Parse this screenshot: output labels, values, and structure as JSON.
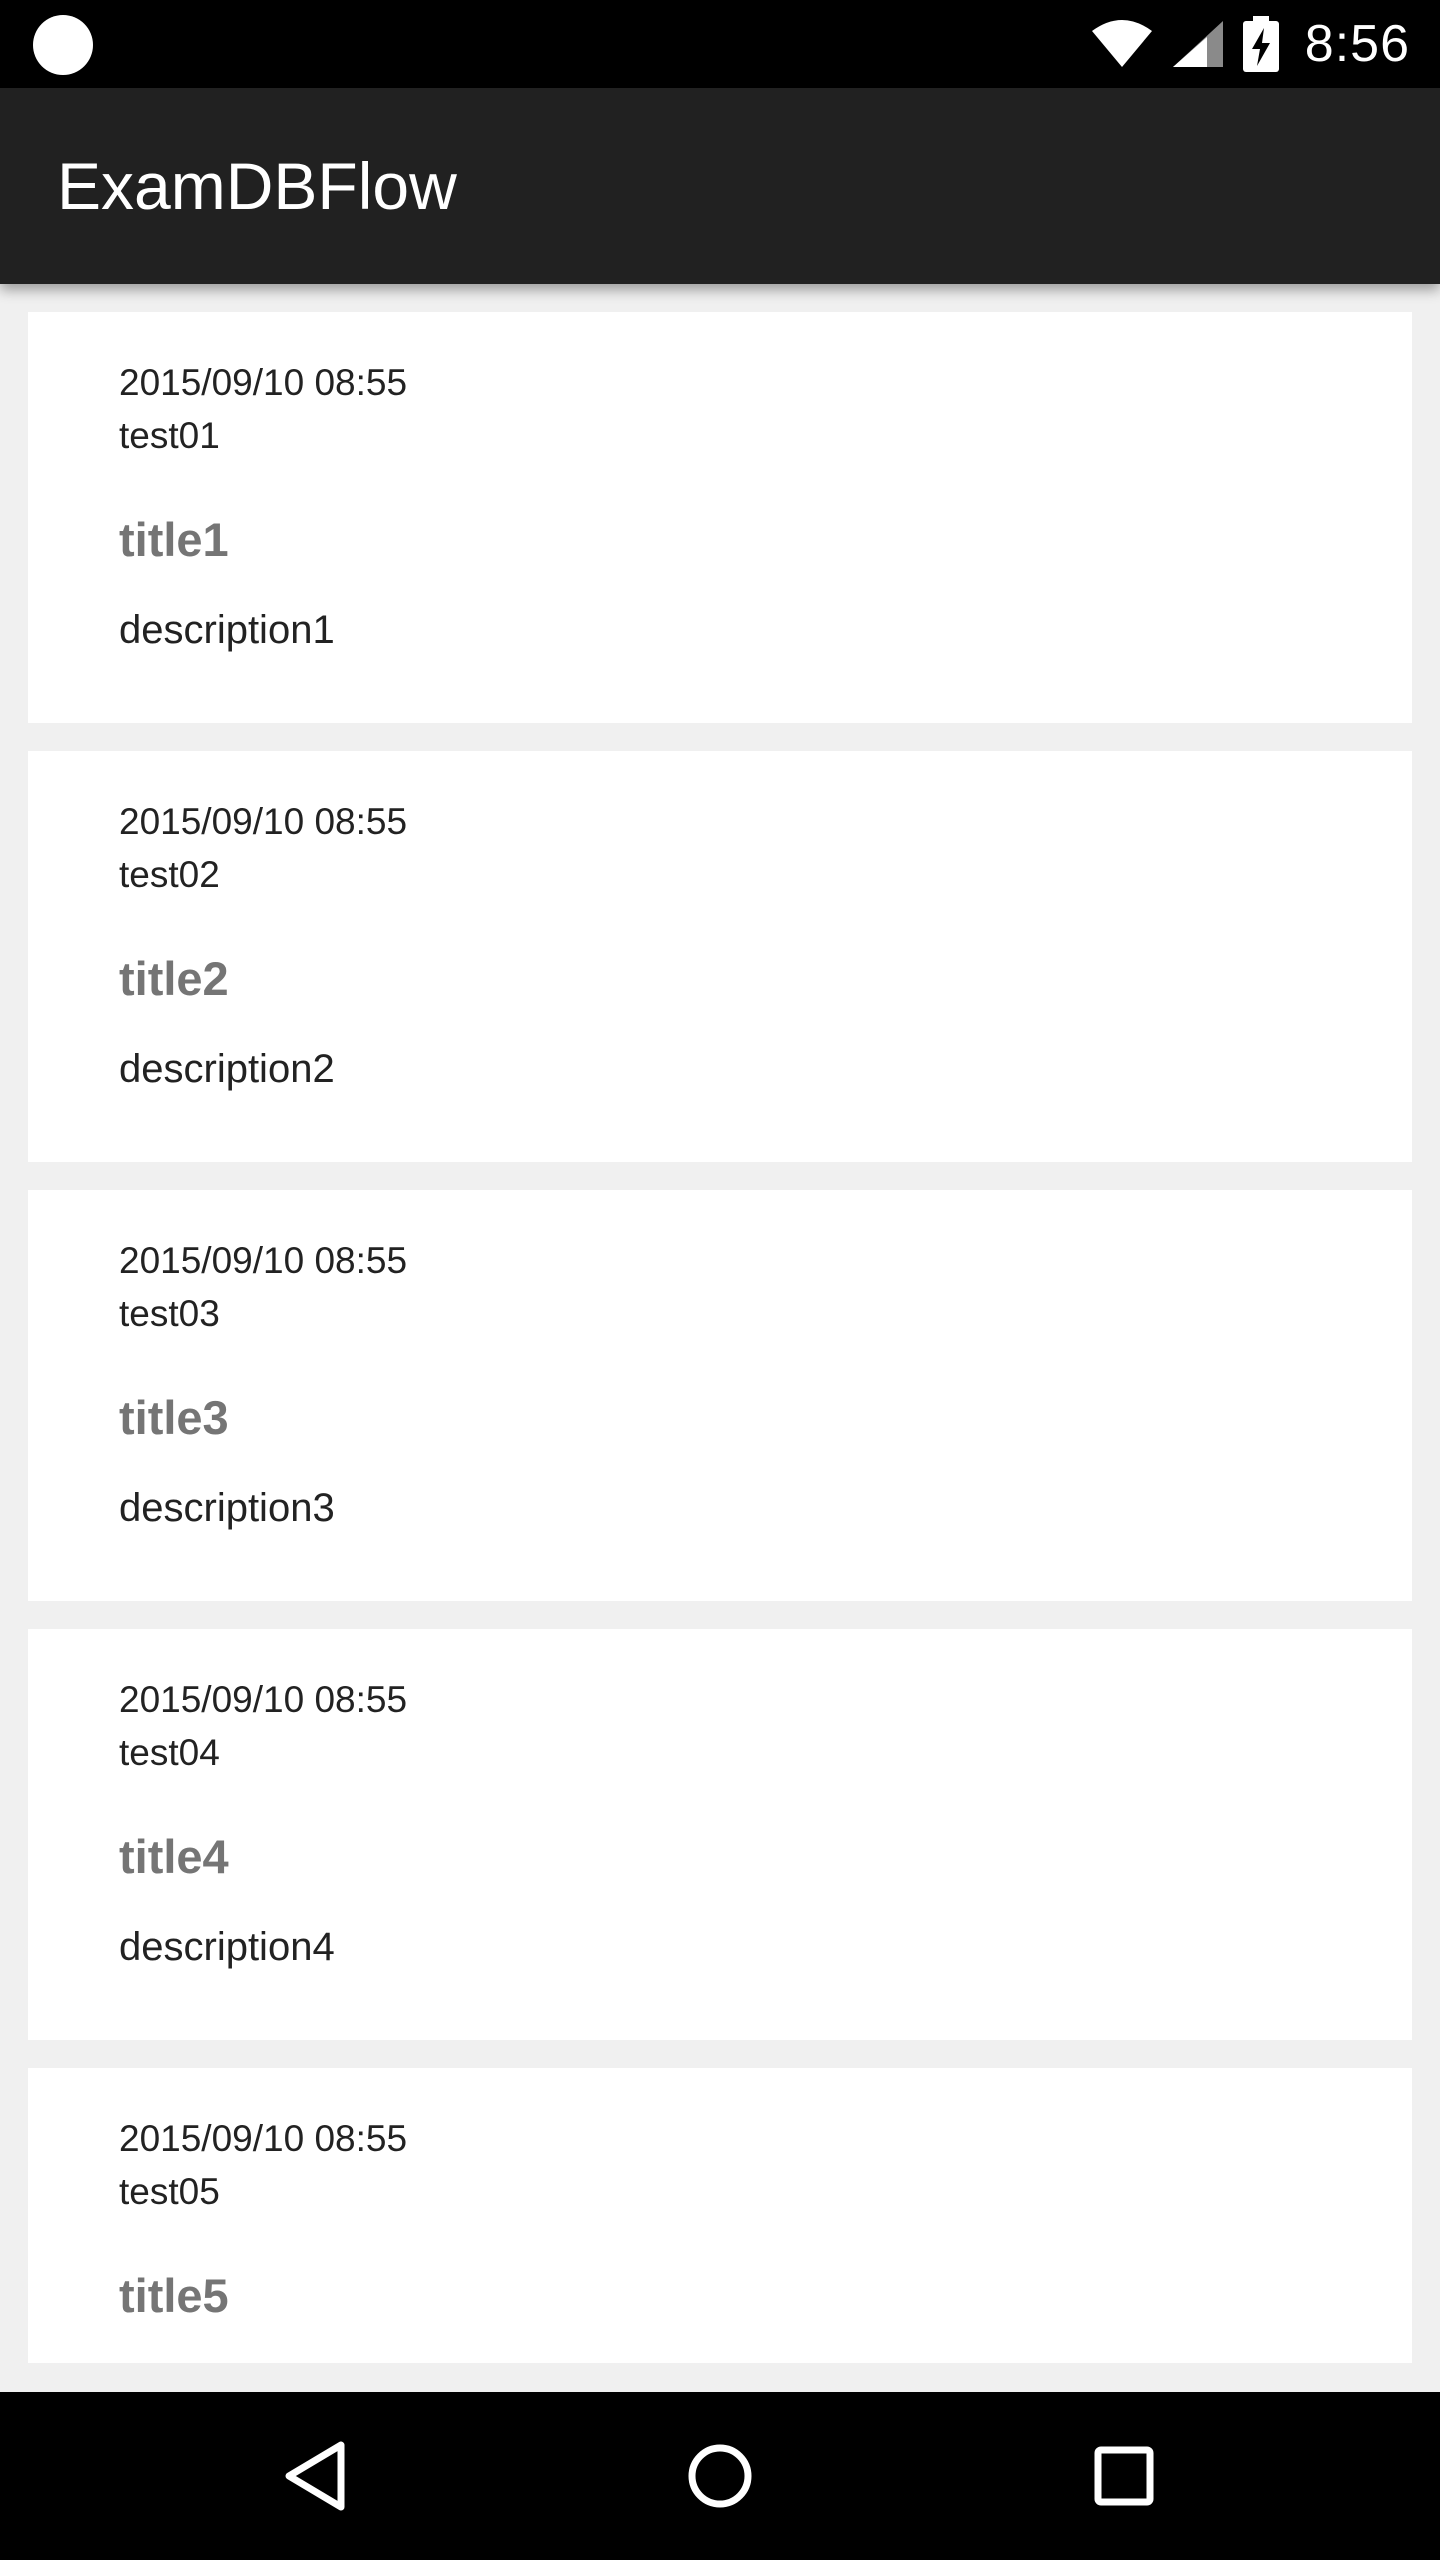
{
  "status_bar": {
    "time": "8:56",
    "icons": [
      "notification-dot-icon",
      "wifi-icon",
      "cell-signal-icon",
      "battery-charging-icon"
    ]
  },
  "app_bar": {
    "title": "ExamDBFlow"
  },
  "items": [
    {
      "date": "2015/09/10 08:55",
      "user": "test01",
      "title": "title1",
      "description": "description1"
    },
    {
      "date": "2015/09/10 08:55",
      "user": "test02",
      "title": "title2",
      "description": "description2"
    },
    {
      "date": "2015/09/10 08:55",
      "user": "test03",
      "title": "title3",
      "description": "description3"
    },
    {
      "date": "2015/09/10 08:55",
      "user": "test04",
      "title": "title4",
      "description": "description4"
    },
    {
      "date": "2015/09/10 08:55",
      "user": "test05",
      "title": "title5",
      "description": ""
    }
  ],
  "nav_bar": {
    "icons": [
      "back-icon",
      "home-icon",
      "recents-icon"
    ]
  },
  "colors": {
    "app_bar": "#212121",
    "background": "#f0f0f0",
    "title_text": "#757575"
  }
}
